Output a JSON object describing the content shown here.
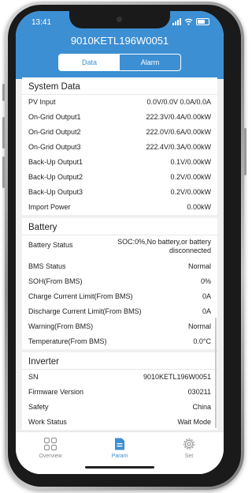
{
  "status_bar": {
    "time": "13:41"
  },
  "header": {
    "device_title": "9010KETL196W0051",
    "tabs": [
      {
        "label": "Data"
      },
      {
        "label": "Alarm"
      }
    ]
  },
  "system_data": {
    "title": "System Data",
    "rows": [
      {
        "label": "PV Input",
        "value": "0.0V/0.0V 0.0A/0.0A"
      },
      {
        "label": "On-Grid Output1",
        "value": "222.3V/0.4A/0.00kW"
      },
      {
        "label": "On-Grid Output2",
        "value": "222.0V/0.6A/0.00kW"
      },
      {
        "label": "On-Grid Output3",
        "value": "222.4V/0.3A/0.00kW"
      },
      {
        "label": "Back-Up Output1",
        "value": "0.1V/0.00kW"
      },
      {
        "label": "Back-Up Output2",
        "value": "0.2V/0.00kW"
      },
      {
        "label": "Back-Up Output3",
        "value": "0.2V/0.00kW"
      },
      {
        "label": "Import Power",
        "value": "0.00kW"
      }
    ]
  },
  "battery": {
    "title": "Battery",
    "status_label": "Battery Status",
    "status_value_line1": "SOC:0%,No battery,or battery",
    "status_value_line2": "disconnected",
    "rows": [
      {
        "label": "BMS Status",
        "value": "Normal"
      },
      {
        "label": "SOH(From BMS)",
        "value": "0%"
      },
      {
        "label": "Charge Current Limit(From BMS)",
        "value": "0A"
      },
      {
        "label": "Discharge Current Limit(From BMS)",
        "value": "0A"
      },
      {
        "label": "Warning(From BMS)",
        "value": "Normal"
      },
      {
        "label": "Temperature(From BMS)",
        "value": "0.0°C"
      }
    ]
  },
  "inverter": {
    "title": "Inverter",
    "rows": [
      {
        "label": "SN",
        "value": "9010KETL196W0051"
      },
      {
        "label": "Firmware Version",
        "value": "030211"
      },
      {
        "label": "Safety",
        "value": "China"
      },
      {
        "label": "Work Status",
        "value": "Wait Mode"
      }
    ]
  },
  "bottom_nav": {
    "items": [
      {
        "label": "Overview",
        "icon": "grid-icon"
      },
      {
        "label": "Param",
        "icon": "document-icon"
      },
      {
        "label": "Set",
        "icon": "gear-icon"
      }
    ],
    "active_index": 1
  },
  "colors": {
    "accent": "#3d8fd3",
    "background": "#f0f0f0",
    "text": "#222222",
    "muted": "#888888"
  }
}
